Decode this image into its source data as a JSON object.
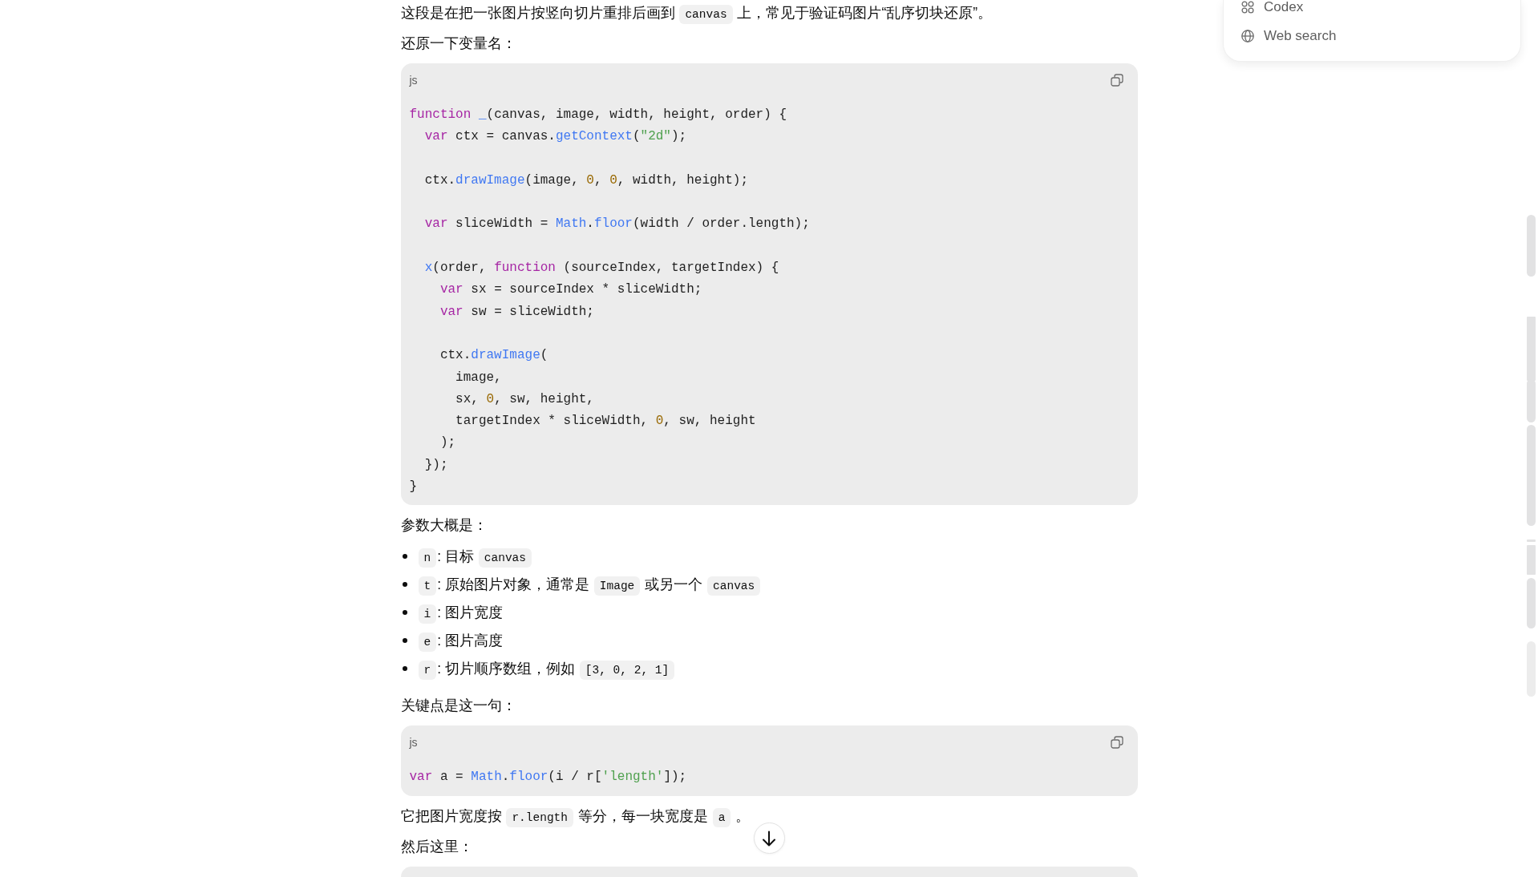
{
  "conversation": {
    "blocks": [
      {
        "kind": "paragraph",
        "segments": [
          {
            "kind": "text",
            "text": "这段是在把一张图片按竖向切片重排后画到 "
          },
          {
            "kind": "code",
            "text": "canvas"
          },
          {
            "kind": "text",
            "text": " 上，常见于验证码图片“乱序切块还原”。"
          }
        ]
      },
      {
        "kind": "paragraph",
        "segments": [
          {
            "kind": "text",
            "text": "还原一下变量名："
          }
        ]
      },
      {
        "kind": "code",
        "language": "js",
        "tokens": [
          {
            "kind": "keyword",
            "text": "function "
          },
          {
            "kind": "function",
            "text": "_"
          },
          {
            "kind": "plain",
            "text": "(canvas, image, width, height, order) {\n  "
          },
          {
            "kind": "keyword",
            "text": "var"
          },
          {
            "kind": "plain",
            "text": " ctx = canvas."
          },
          {
            "kind": "function",
            "text": "getContext"
          },
          {
            "kind": "plain",
            "text": "("
          },
          {
            "kind": "string",
            "text": "\"2d\""
          },
          {
            "kind": "plain",
            "text": ");\n\n  ctx."
          },
          {
            "kind": "function",
            "text": "drawImage"
          },
          {
            "kind": "plain",
            "text": "(image, "
          },
          {
            "kind": "number",
            "text": "0"
          },
          {
            "kind": "plain",
            "text": ", "
          },
          {
            "kind": "number",
            "text": "0"
          },
          {
            "kind": "plain",
            "text": ", width, height);\n\n  "
          },
          {
            "kind": "keyword",
            "text": "var"
          },
          {
            "kind": "plain",
            "text": " sliceWidth = "
          },
          {
            "kind": "builtin",
            "text": "Math"
          },
          {
            "kind": "plain",
            "text": "."
          },
          {
            "kind": "function",
            "text": "floor"
          },
          {
            "kind": "plain",
            "text": "(width / order.length);\n\n  "
          },
          {
            "kind": "function",
            "text": "x"
          },
          {
            "kind": "plain",
            "text": "(order, "
          },
          {
            "kind": "keyword",
            "text": "function"
          },
          {
            "kind": "plain",
            "text": " (sourceIndex, targetIndex) {\n    "
          },
          {
            "kind": "keyword",
            "text": "var"
          },
          {
            "kind": "plain",
            "text": " sx = sourceIndex * sliceWidth;\n    "
          },
          {
            "kind": "keyword",
            "text": "var"
          },
          {
            "kind": "plain",
            "text": " sw = sliceWidth;\n\n    ctx."
          },
          {
            "kind": "function",
            "text": "drawImage"
          },
          {
            "kind": "plain",
            "text": "(\n      image,\n      sx, "
          },
          {
            "kind": "number",
            "text": "0"
          },
          {
            "kind": "plain",
            "text": ", sw, height,\n      targetIndex * sliceWidth, "
          },
          {
            "kind": "number",
            "text": "0"
          },
          {
            "kind": "plain",
            "text": ", sw, height\n    );\n  });\n}"
          }
        ]
      },
      {
        "kind": "paragraph",
        "segments": [
          {
            "kind": "text",
            "text": "参数大概是："
          }
        ]
      },
      {
        "kind": "list",
        "items": [
          {
            "segments": [
              {
                "kind": "code",
                "text": "n"
              },
              {
                "kind": "text",
                "text": ": 目标 "
              },
              {
                "kind": "code",
                "text": "canvas"
              }
            ]
          },
          {
            "segments": [
              {
                "kind": "code",
                "text": "t"
              },
              {
                "kind": "text",
                "text": ": 原始图片对象，通常是 "
              },
              {
                "kind": "code",
                "text": "Image"
              },
              {
                "kind": "text",
                "text": " 或另一个 "
              },
              {
                "kind": "code",
                "text": "canvas"
              }
            ]
          },
          {
            "segments": [
              {
                "kind": "code",
                "text": "i"
              },
              {
                "kind": "text",
                "text": ": 图片宽度"
              }
            ]
          },
          {
            "segments": [
              {
                "kind": "code",
                "text": "e"
              },
              {
                "kind": "text",
                "text": ": 图片高度"
              }
            ]
          },
          {
            "segments": [
              {
                "kind": "code",
                "text": "r"
              },
              {
                "kind": "text",
                "text": ": 切片顺序数组，例如 "
              },
              {
                "kind": "code",
                "text": "[3, 0, 2, 1]"
              }
            ]
          }
        ]
      },
      {
        "kind": "paragraph",
        "segments": [
          {
            "kind": "text",
            "text": "关键点是这一句："
          }
        ]
      },
      {
        "kind": "code",
        "language": "js",
        "tokens": [
          {
            "kind": "keyword",
            "text": "var"
          },
          {
            "kind": "plain",
            "text": " a = "
          },
          {
            "kind": "builtin",
            "text": "Math"
          },
          {
            "kind": "plain",
            "text": "."
          },
          {
            "kind": "function",
            "text": "floor"
          },
          {
            "kind": "plain",
            "text": "(i / r["
          },
          {
            "kind": "string",
            "text": "'length'"
          },
          {
            "kind": "plain",
            "text": "]);"
          }
        ]
      },
      {
        "kind": "paragraph",
        "segments": [
          {
            "kind": "text",
            "text": "它把图片宽度按 "
          },
          {
            "kind": "code",
            "text": "r.length"
          },
          {
            "kind": "text",
            "text": " 等分，每一块宽度是 "
          },
          {
            "kind": "code",
            "text": "a"
          },
          {
            "kind": "text",
            "text": " 。"
          }
        ]
      },
      {
        "kind": "paragraph",
        "segments": [
          {
            "kind": "text",
            "text": "然后这里："
          }
        ]
      },
      {
        "kind": "code"
      }
    ]
  },
  "tools_menu": {
    "items": [
      {
        "kind": "codex",
        "label": "Codex"
      },
      {
        "kind": "search",
        "label": "Web search"
      }
    ]
  }
}
